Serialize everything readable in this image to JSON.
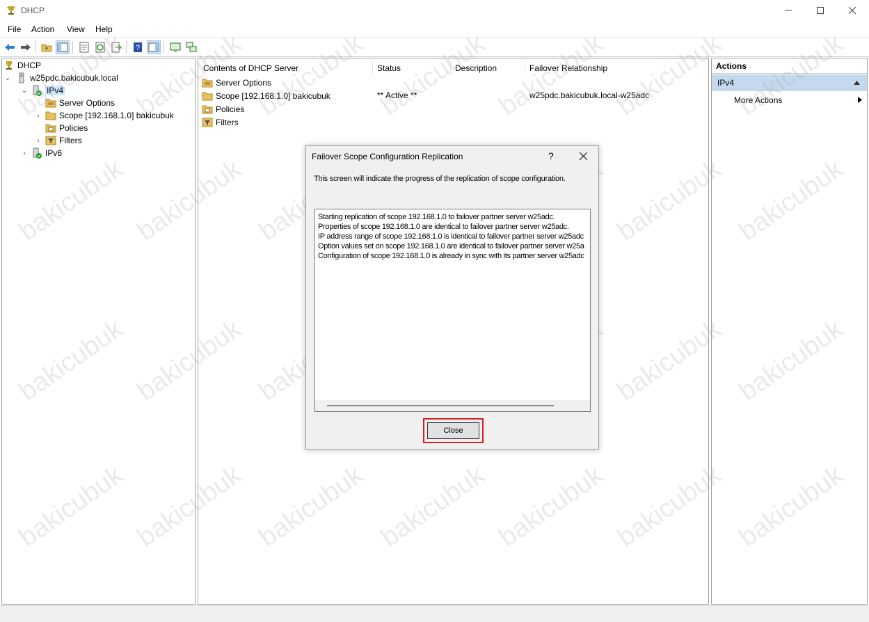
{
  "window": {
    "title": "DHCP"
  },
  "menu": [
    "File",
    "Action",
    "View",
    "Help"
  ],
  "tree": {
    "root": "DHCP",
    "server": "w25pdc.bakicubuk.local",
    "ipv4": "IPv4",
    "children": [
      "Server Options",
      "Scope [192.168.1.0] bakicubuk",
      "Policies",
      "Filters"
    ],
    "ipv6": "IPv6"
  },
  "content": {
    "columns": [
      "Contents of DHCP Server",
      "Status",
      "Description",
      "Failover Relationship"
    ],
    "rows": [
      {
        "name": "Server Options",
        "status": "",
        "description": "",
        "failover": ""
      },
      {
        "name": "Scope [192.168.1.0] bakicubuk",
        "status": "** Active **",
        "description": "",
        "failover": "w25pdc.bakicubuk.local-w25adc"
      },
      {
        "name": "Policies",
        "status": "",
        "description": "",
        "failover": ""
      },
      {
        "name": "Filters",
        "status": "",
        "description": "",
        "failover": ""
      }
    ]
  },
  "actions": {
    "title": "Actions",
    "group": "IPv4",
    "items": [
      "More Actions"
    ]
  },
  "dialog": {
    "title": "Failover Scope Configuration Replication",
    "help": "?",
    "description": "This screen will indicate the progress of the replication of scope configuration.",
    "log": [
      "Starting replication of scope 192.168.1.0 to failover partner server w25adc.",
      "Properties of scope 192.168.1.0 are identical to failover partner server w25adc.",
      "IP address range of scope 192.168.1.0 is identical to failover partner server w25adc",
      "Option values set on scope 192.168.1.0 are identical to failover partner server w25a",
      "Configuration of scope 192.168.1.0 is already in sync with its partner server w25adc"
    ],
    "close_label": "Close"
  },
  "watermark": "bakicubuk",
  "colors": {
    "highlight": "#d42020",
    "selection": "#cce8ff",
    "actions_header": "#c4d9ee",
    "folder": "#e8c060"
  }
}
